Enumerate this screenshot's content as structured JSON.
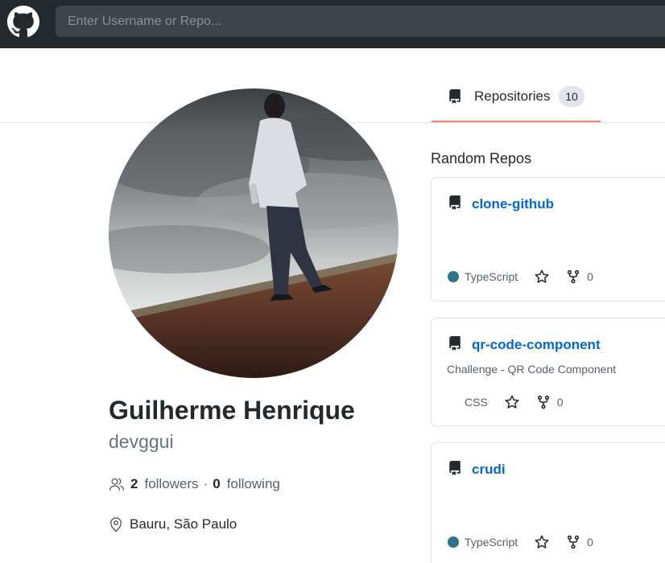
{
  "header": {
    "search_placeholder": "Enter Username or Repo..."
  },
  "tabs": [
    {
      "label": "Repositories",
      "count": "10",
      "icon": "book-icon"
    }
  ],
  "profile": {
    "name": "Guilherme Henrique",
    "login": "devggui",
    "followers_count": "2",
    "followers_label": "followers",
    "separator": "·",
    "following_count": "0",
    "following_label": "following",
    "location": "Bauru, São Paulo"
  },
  "random_repos": {
    "title": "Random Repos",
    "items": [
      {
        "name": "clone-github",
        "description": "",
        "language": "TypeScript",
        "language_color": "#2b7489",
        "forks": "0"
      },
      {
        "name": "qr-code-component",
        "description": "Challenge - QR Code Component",
        "language": "CSS",
        "language_color": "",
        "forks": "0"
      },
      {
        "name": "crudi",
        "description": "",
        "language": "TypeScript",
        "language_color": "#2b7489",
        "forks": "0"
      }
    ]
  },
  "colors": {
    "header_bg": "#24292e",
    "tab_underline": "#f9826c",
    "link": "#0366d6"
  }
}
